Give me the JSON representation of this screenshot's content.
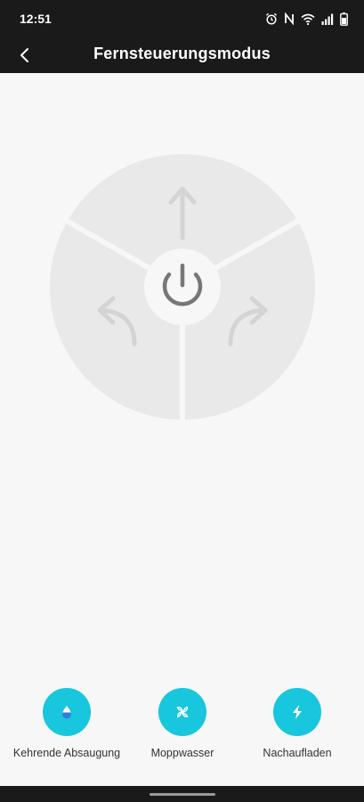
{
  "status_bar": {
    "time": "12:51",
    "icons": [
      "alarm-icon",
      "nfc-icon",
      "wifi-icon",
      "signal-icon",
      "battery-icon"
    ]
  },
  "header": {
    "back_icon": "chevron-left-icon",
    "title": "Fernsteuerungsmodus"
  },
  "joystick": {
    "center_icon": "power-icon",
    "segments": [
      {
        "direction": "forward",
        "icon": "arrow-up-icon"
      },
      {
        "direction": "turn-left",
        "icon": "arrow-turn-left-icon"
      },
      {
        "direction": "turn-right",
        "icon": "arrow-turn-right-icon"
      }
    ]
  },
  "actions": [
    {
      "label": "Kehrende Absaugung",
      "icon": "water-drop-icon"
    },
    {
      "label": "Moppwasser",
      "icon": "fan-icon"
    },
    {
      "label": "Nachaufladen",
      "icon": "lightning-icon"
    }
  ],
  "colors": {
    "accent": "#18c6dd",
    "bar_background": "#1a1a1a",
    "page_background": "#f7f7f7",
    "joystick_segment": "#e9e9e9",
    "joystick_arrow": "#d4d4d4",
    "power_icon": "#777777"
  }
}
